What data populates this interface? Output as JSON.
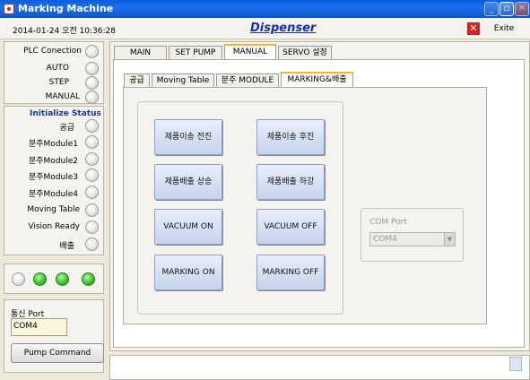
{
  "window": {
    "title": "Marking Machine"
  },
  "header": {
    "datetime": "2014-01-24 오전 10:36:28",
    "app_name": "Dispenser",
    "exit_label": "Exite"
  },
  "left": {
    "plc_items": [
      {
        "label": "PLC Conection"
      },
      {
        "label": "AUTO"
      },
      {
        "label": "STEP"
      },
      {
        "label": "MANUAL"
      }
    ],
    "status_head": "Initialize  Status",
    "status_items": [
      {
        "label": "공급"
      },
      {
        "label": "분주Module1"
      },
      {
        "label": "분주Module2"
      },
      {
        "label": "분주Module3"
      },
      {
        "label": "분주Module4"
      },
      {
        "label": "Moving Table"
      },
      {
        "label": "Vision Ready"
      },
      {
        "label": "배출"
      }
    ],
    "leds": [
      "off",
      "on",
      "on",
      "on"
    ],
    "port_label": "통신 Port",
    "port_value": "COM4",
    "pump_button": "Pump Command"
  },
  "tabs": [
    "MAIN",
    "SET PUMP",
    "MANUAL",
    "SERVO 설정"
  ],
  "active_tab": "MANUAL",
  "subtabs": [
    "공급",
    "Moving Table",
    "분주 MODULE",
    "MARKING&배출"
  ],
  "active_subtab": "MARKING&배출",
  "buttons": [
    "제품이송 전진",
    "제품이송 후진",
    "제품배출 상승",
    "제품배출 하강",
    "VACUUM ON",
    "VACUUM OFF",
    "MARKING ON",
    "MARKING OFF"
  ],
  "com": {
    "label": "COM Port",
    "value": "COM4"
  },
  "colors": {
    "titlebar": "#0a5fd8",
    "accent": "#1a33a6",
    "led_on": "#3cc42a",
    "tab_active": "#f3b337"
  }
}
